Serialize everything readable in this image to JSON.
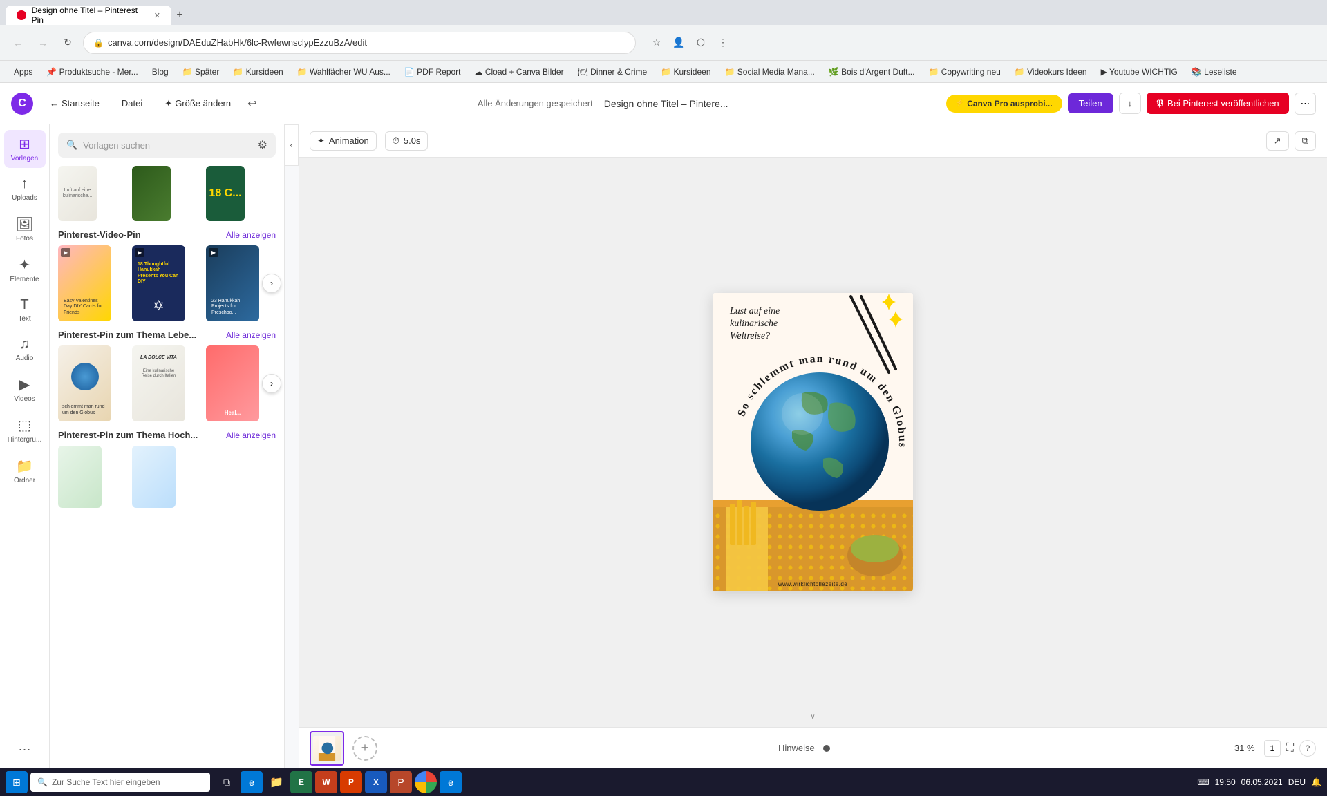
{
  "browser": {
    "tab_active": "Design ohne Titel – Pinterest Pin",
    "address": "canva.com/design/DAEduZHabHk/6lc-RwfewnsclypEzzuBzA/edit",
    "bookmarks": [
      "Apps",
      "Produktsuche - Mer...",
      "Blog",
      "Später",
      "Kursideen",
      "Wahlfächer WU Aus...",
      "PDF Report",
      "Cload + Canva Bilder",
      "Dinner & Crime",
      "Kursideen",
      "Social Media Mana...",
      "Bois d'Argent Duft...",
      "Copywriting neu",
      "Videokurs Ideen",
      "Youtube WICHTIG",
      "Leseliste"
    ]
  },
  "topbar": {
    "home_label": "Startseite",
    "file_label": "Datei",
    "resize_label": "Größe ändern",
    "saved_label": "Alle Änderungen gespeichert",
    "design_name": "Design ohne Titel – Pintere...",
    "pro_label": "Canva Pro ausprobi...",
    "share_label": "Teilen",
    "pinterest_label": "Bei Pinterest veröffentlichen"
  },
  "toolbar": {
    "animation_label": "Animation",
    "duration_label": "5.0s"
  },
  "tools": [
    {
      "name": "Vorlagen",
      "icon": "⊞"
    },
    {
      "name": "Uploads",
      "icon": "↑"
    },
    {
      "name": "Fotos",
      "icon": "🖼"
    },
    {
      "name": "Elemente",
      "icon": "✦"
    },
    {
      "name": "Text",
      "icon": "T"
    },
    {
      "name": "Audio",
      "icon": "♫"
    },
    {
      "name": "Videos",
      "icon": "▶"
    },
    {
      "name": "Hintergru...",
      "icon": "⬚"
    },
    {
      "name": "Ordner",
      "icon": "📁"
    },
    {
      "name": "...",
      "icon": "⋯"
    }
  ],
  "panel": {
    "search_placeholder": "Vorlagen suchen",
    "sections": [
      {
        "title": "Pinterest-Video-Pin",
        "see_all": "Alle anzeigen",
        "templates": [
          {
            "label": "Easy Valentines Day DIY Cards for Friends",
            "color": "tc-4"
          },
          {
            "label": "18 Thoughtful Hanukkah Presents You Can DIY",
            "color": "tc-5"
          },
          {
            "label": "23 Hanukkah Projects for Preschoo...",
            "color": "tc-3"
          }
        ]
      },
      {
        "title": "Pinterest-Pin zum Thema Lebe...",
        "see_all": "Alle anzeigen",
        "templates": [
          {
            "label": "schlemmt man rund um den Globus",
            "color": "tc-7"
          },
          {
            "label": "LA DOLCE VITA Eine kulinarische Reise durch Italien",
            "color": "tc-1"
          },
          {
            "label": "Heal...",
            "color": "tc-8"
          }
        ]
      },
      {
        "title": "Pinterest-Pin zum Thema Hoch...",
        "see_all": "Alle anzeigen",
        "templates": [
          {
            "label": "",
            "color": "tc-6"
          },
          {
            "label": "",
            "color": "tc-9"
          }
        ]
      }
    ]
  },
  "design": {
    "text_top": "Lust auf eine\nkulinarische\nWeltreise?",
    "curved_text": "So schlemmt man rund um den Globus",
    "url": "www.wirklichtollezeite.de"
  },
  "canvas": {
    "zoom": "31 %",
    "hint": "Hinweise",
    "page_current": "1"
  },
  "datetime": "19:50\n06.05.2021",
  "taskbar_search": "Zur Suche Text hier eingeben"
}
